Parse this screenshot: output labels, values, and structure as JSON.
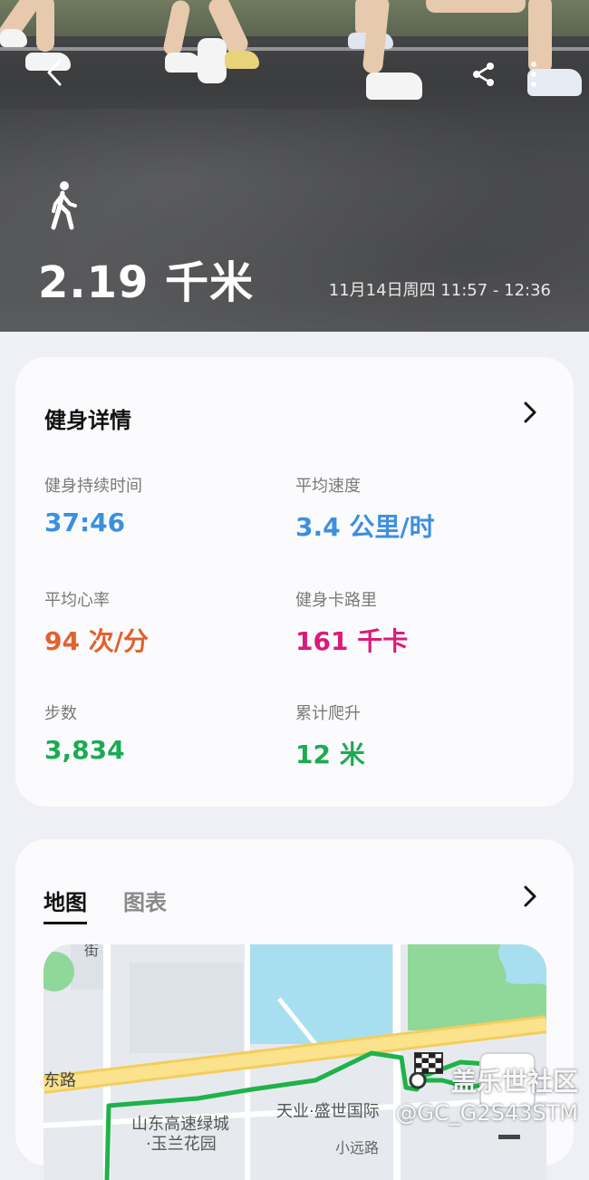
{
  "header": {
    "distance": "2.19 千米",
    "datetime": "11月14日周四 11:57 - 12:36"
  },
  "details": {
    "title": "健身详情",
    "metrics": [
      {
        "label": "健身持续时间",
        "value": "37:46",
        "color": "#3c8fe0"
      },
      {
        "label": "平均速度",
        "value": "3.4 公里/时",
        "color": "#3c8fe0"
      },
      {
        "label": "平均心率",
        "value": "94 次/分",
        "color": "#e2612f"
      },
      {
        "label": "健身卡路里",
        "value": "161 千卡",
        "color": "#d81b7a"
      },
      {
        "label": "步数",
        "value": "3,834",
        "color": "#1daa55"
      },
      {
        "label": "累计爬升",
        "value": "12 米",
        "color": "#1daa55"
      }
    ]
  },
  "map_card": {
    "tabs": [
      {
        "label": "地图",
        "active": true
      },
      {
        "label": "图表",
        "active": false
      }
    ],
    "map_labels": {
      "street_top": "街",
      "road_left": "东路",
      "place1_line1": "山东高速绿城",
      "place1_line2": "·玉兰花园",
      "place2": "天业·盛世国际",
      "road_bottom": "小远路"
    }
  },
  "watermark": {
    "line1": "盖乐世社区",
    "line2": "@GC_G2S43STM"
  },
  "icons": [
    "back-arrow-icon",
    "share-icon",
    "more-vertical-icon",
    "walking-person-icon",
    "chevron-right-icon",
    "finish-flag-icon"
  ]
}
